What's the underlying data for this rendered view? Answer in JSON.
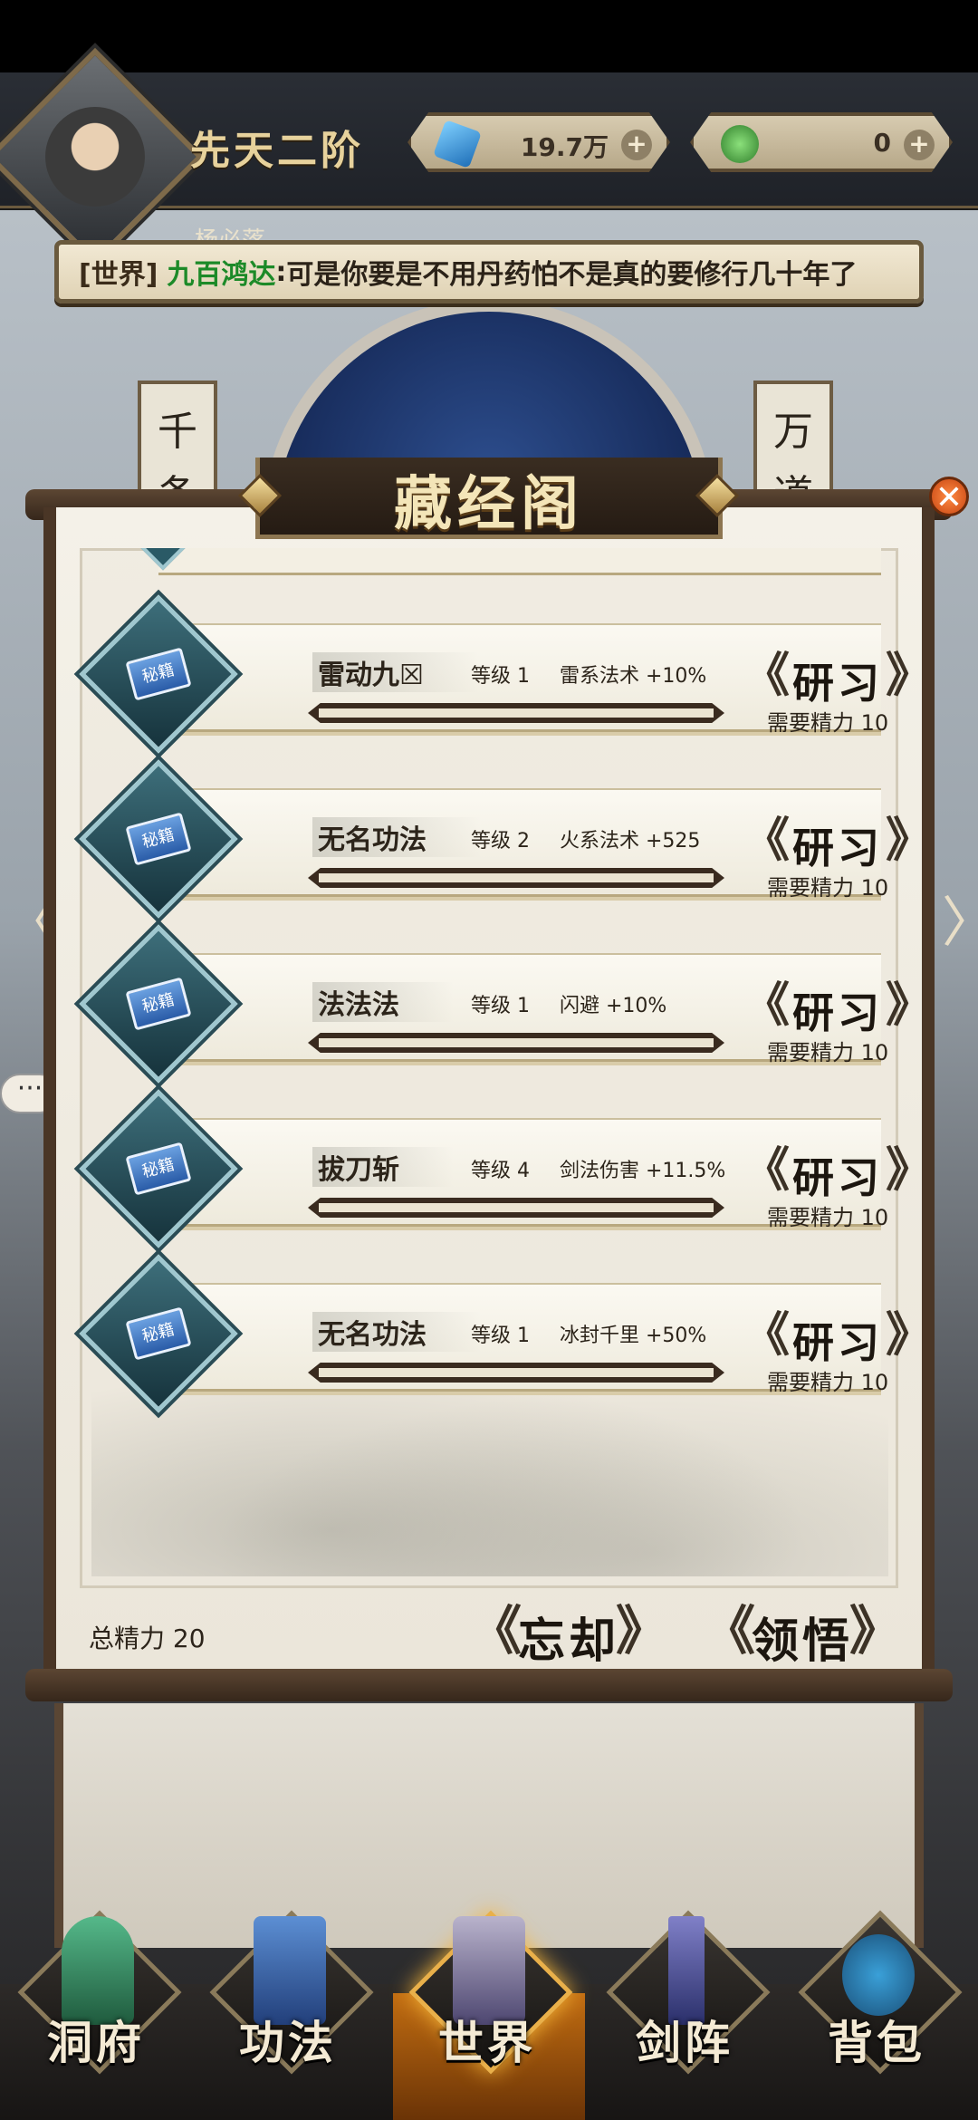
{
  "header": {
    "realm": "先天二阶",
    "currency": [
      {
        "icon": "blue-gem-icon",
        "value": "19.7万"
      },
      {
        "icon": "green-jade-icon",
        "value": "0"
      }
    ],
    "plus_symbol": "+",
    "player_name": "杨必落"
  },
  "chat": {
    "channel": "[世界]",
    "user": "九百鸿达",
    "separator": ":",
    "message": "可是你要是不用丹药怕不是真的要修行几十年了"
  },
  "scene": {
    "banner_left": "千条",
    "banner_right": "万道",
    "side_left": "〈",
    "side_right": "〉",
    "bubble": "···"
  },
  "panel": {
    "title": "藏经阁",
    "close_symbol": "✕",
    "skills": [
      {
        "name": "雷动九☒",
        "level": "等级 1",
        "effect": "雷系法术 +10%",
        "button": "研习",
        "cost": "需要精力 10",
        "progress": 0
      },
      {
        "name": "无名功法",
        "level": "等级 2",
        "effect": "火系法术 +525",
        "button": "研习",
        "cost": "需要精力 10",
        "progress": 0
      },
      {
        "name": "法法法",
        "level": "等级 1",
        "effect": "闪避 +10%",
        "button": "研习",
        "cost": "需要精力 10",
        "progress": 0
      },
      {
        "name": "拔刀斩",
        "level": "等级 4",
        "effect": "剑法伤害 +11.5%",
        "button": "研习",
        "cost": "需要精力 10",
        "progress": 0
      },
      {
        "name": "无名功法",
        "level": "等级 1",
        "effect": "冰封千里 +50%",
        "button": "研习",
        "cost": "需要精力 10",
        "progress": 0
      }
    ],
    "book_glyph": "秘籍",
    "bracket_left": "《",
    "bracket_right": "》",
    "total_stamina": "总精力 20",
    "forget_button": "忘却",
    "comprehend_button": "领悟"
  },
  "nav": {
    "items": [
      {
        "label": "洞府",
        "icon": "cave-dwelling-icon"
      },
      {
        "label": "功法",
        "icon": "manual-book-icon"
      },
      {
        "label": "世界",
        "icon": "world-mountain-icon"
      },
      {
        "label": "剑阵",
        "icon": "sword-array-icon"
      },
      {
        "label": "背包",
        "icon": "bag-icon"
      }
    ],
    "active_index": 2
  }
}
